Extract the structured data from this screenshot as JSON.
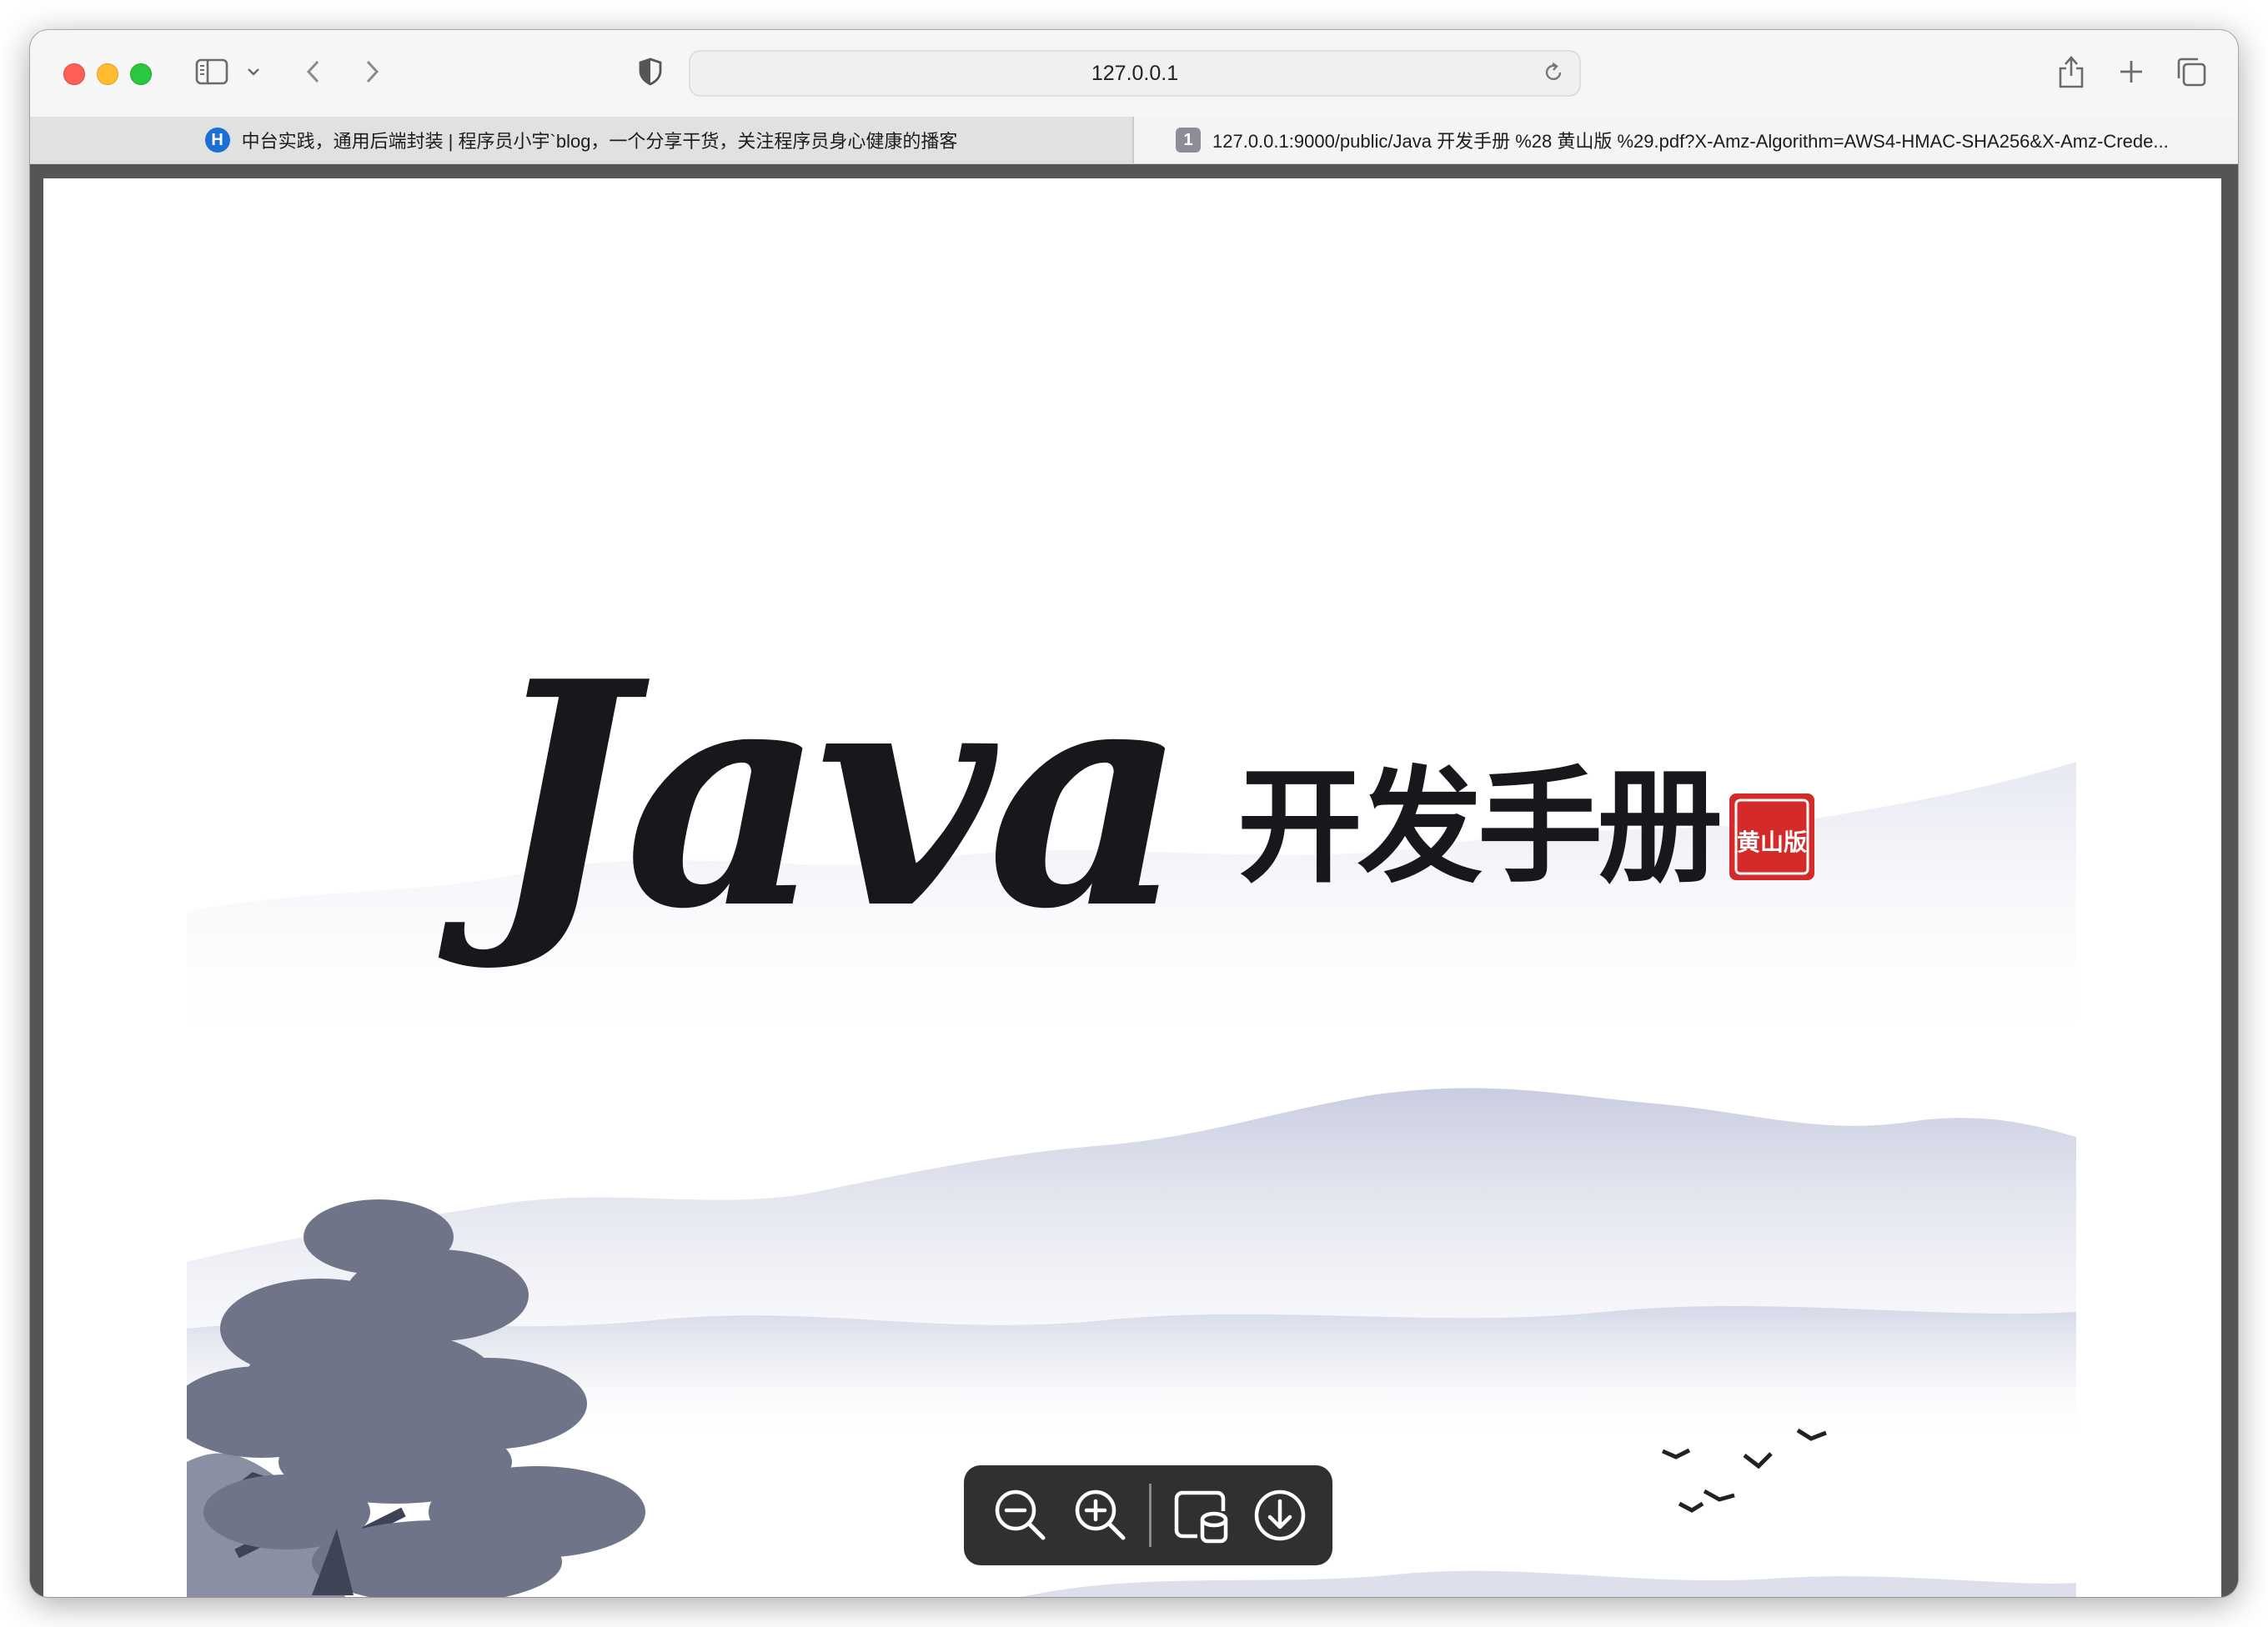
{
  "browser": {
    "address": "127.0.0.1",
    "tabs": [
      {
        "favicon": "H",
        "title": "中台实践，通用后端封装 | 程序员小宇`blog，一个分享干货，关注程序员身心健康的播客"
      },
      {
        "favicon": "1",
        "title": "127.0.0.1:9000/public/Java 开发手册 %28 黄山版 %29.pdf?X-Amz-Algorithm=AWS4-HMAC-SHA256&X-Amz-Crede..."
      }
    ]
  },
  "document": {
    "title_latin": "Java",
    "title_cn": "开发手册",
    "seal_text": "黄山版"
  },
  "pdf_toolbar": {
    "buttons": [
      "zoom-out-icon",
      "zoom-in-icon",
      "open-in-preview-icon",
      "download-icon"
    ]
  },
  "colors": {
    "traffic_red": "#fe5f57",
    "traffic_yellow": "#febc2e",
    "traffic_green": "#28c840",
    "seal_red": "#d42a2a",
    "ink": "#17181c"
  }
}
